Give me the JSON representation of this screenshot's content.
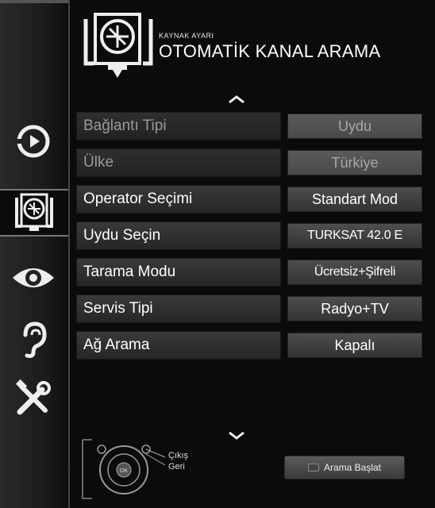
{
  "header": {
    "subtitle": "KAYNAK AYARI",
    "title": "OTOMATİK KANAL ARAMA"
  },
  "rail": {
    "items": [
      {
        "icon": "source-icon"
      },
      {
        "icon": "satellite-dish-icon",
        "active": true
      },
      {
        "icon": "eye-icon"
      },
      {
        "icon": "ear-icon"
      },
      {
        "icon": "tools-icon"
      }
    ]
  },
  "menu": {
    "rows": [
      {
        "label": "Bağlantı Tipi",
        "value": "Uydu",
        "enabled": false
      },
      {
        "label": "Ülke",
        "value": "Türkiye",
        "enabled": false
      },
      {
        "label": "Operator Seçimi",
        "value": "Standart Mod",
        "enabled": true
      },
      {
        "label": "Uydu Seçin",
        "value": "TURKSAT 42.0 E",
        "enabled": true
      },
      {
        "label": "Tarama Modu",
        "value": "Ücretsiz+Şifreli",
        "enabled": true
      },
      {
        "label": "Servis Tipi",
        "value": "Radyo+TV",
        "enabled": true
      },
      {
        "label": "Ağ Arama",
        "value": "Kapalı",
        "enabled": true
      }
    ]
  },
  "footer": {
    "exit_label": "Çıkış",
    "back_label": "Geri",
    "remote_ok_label": "OK",
    "start_button_label": "Arama Başlat",
    "start_button_color": "#cc0000"
  }
}
